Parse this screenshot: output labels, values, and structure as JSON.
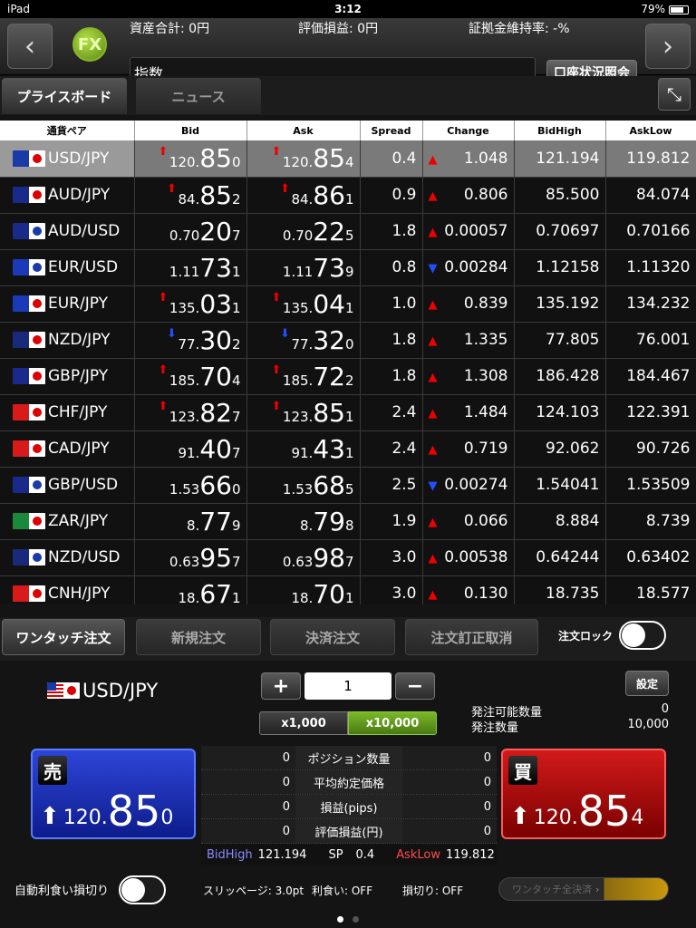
{
  "status": {
    "device": "iPad",
    "time": "3:12",
    "battery": "79%"
  },
  "header": {
    "total_assets": "資産合計: 0円",
    "unrealized_pl": "評価損益: 0円",
    "margin_ratio": "証拠金維持率: -%",
    "search_value": "指数",
    "account_button": "口座状況照会",
    "logo": "FX"
  },
  "tabs": {
    "price_board": "プライスボード",
    "news": "ニュース"
  },
  "columns": [
    "通貨ペア",
    "Bid",
    "Ask",
    "Spread",
    "Change",
    "BidHigh",
    "AskLow"
  ],
  "rates": [
    {
      "pair": "USD/JPY",
      "flag1": "#1a3aa8",
      "flag2dot": "#d00",
      "bid_a": "120.",
      "bid_b": "85",
      "bid_c": "0",
      "bid_dir": "up",
      "ask_a": "120.",
      "ask_b": "85",
      "ask_c": "4",
      "ask_dir": "up",
      "spread": "0.4",
      "change": "1.048",
      "change_dir": "up",
      "high": "121.194",
      "low": "119.812"
    },
    {
      "pair": "AUD/JPY",
      "flag1": "#1a2a8a",
      "flag2dot": "#d00",
      "bid_a": "84.",
      "bid_b": "85",
      "bid_c": "2",
      "bid_dir": "up",
      "ask_a": "84.",
      "ask_b": "86",
      "ask_c": "1",
      "ask_dir": "up",
      "spread": "0.9",
      "change": "0.806",
      "change_dir": "up",
      "high": "85.500",
      "low": "84.074"
    },
    {
      "pair": "AUD/USD",
      "flag1": "#1a2a8a",
      "flag2dot": "#1a3aa8",
      "bid_a": "0.70",
      "bid_b": "20",
      "bid_c": "7",
      "bid_dir": "",
      "ask_a": "0.70",
      "ask_b": "22",
      "ask_c": "5",
      "ask_dir": "",
      "spread": "1.8",
      "change": "0.00057",
      "change_dir": "up",
      "high": "0.70697",
      "low": "0.70166"
    },
    {
      "pair": "EUR/USD",
      "flag1": "#1a3ab8",
      "flag2dot": "#1a3aa8",
      "bid_a": "1.11",
      "bid_b": "73",
      "bid_c": "1",
      "bid_dir": "",
      "ask_a": "1.11",
      "ask_b": "73",
      "ask_c": "9",
      "ask_dir": "",
      "spread": "0.8",
      "change": "0.00284",
      "change_dir": "dn",
      "high": "1.12158",
      "low": "1.11320"
    },
    {
      "pair": "EUR/JPY",
      "flag1": "#1a3ab8",
      "flag2dot": "#d00",
      "bid_a": "135.",
      "bid_b": "03",
      "bid_c": "1",
      "bid_dir": "up",
      "ask_a": "135.",
      "ask_b": "04",
      "ask_c": "1",
      "ask_dir": "up",
      "spread": "1.0",
      "change": "0.839",
      "change_dir": "up",
      "high": "135.192",
      "low": "134.232"
    },
    {
      "pair": "NZD/JPY",
      "flag1": "#1a2a7a",
      "flag2dot": "#d00",
      "bid_a": "77.",
      "bid_b": "30",
      "bid_c": "2",
      "bid_dir": "dn",
      "ask_a": "77.",
      "ask_b": "32",
      "ask_c": "0",
      "ask_dir": "dn",
      "spread": "1.8",
      "change": "1.335",
      "change_dir": "up",
      "high": "77.805",
      "low": "76.001"
    },
    {
      "pair": "GBP/JPY",
      "flag1": "#1a2a8a",
      "flag2dot": "#d00",
      "bid_a": "185.",
      "bid_b": "70",
      "bid_c": "4",
      "bid_dir": "up",
      "ask_a": "185.",
      "ask_b": "72",
      "ask_c": "2",
      "ask_dir": "up",
      "spread": "1.8",
      "change": "1.308",
      "change_dir": "up",
      "high": "186.428",
      "low": "184.467"
    },
    {
      "pair": "CHF/JPY",
      "flag1": "#d81a1a",
      "flag2dot": "#d00",
      "bid_a": "123.",
      "bid_b": "82",
      "bid_c": "7",
      "bid_dir": "up",
      "ask_a": "123.",
      "ask_b": "85",
      "ask_c": "1",
      "ask_dir": "up",
      "spread": "2.4",
      "change": "1.484",
      "change_dir": "up",
      "high": "124.103",
      "low": "122.391"
    },
    {
      "pair": "CAD/JPY",
      "flag1": "#d81a1a",
      "flag2dot": "#d00",
      "bid_a": "91.",
      "bid_b": "40",
      "bid_c": "7",
      "bid_dir": "",
      "ask_a": "91.",
      "ask_b": "43",
      "ask_c": "1",
      "ask_dir": "",
      "spread": "2.4",
      "change": "0.719",
      "change_dir": "up",
      "high": "92.062",
      "low": "90.726"
    },
    {
      "pair": "GBP/USD",
      "flag1": "#1a2a8a",
      "flag2dot": "#1a3aa8",
      "bid_a": "1.53",
      "bid_b": "66",
      "bid_c": "0",
      "bid_dir": "",
      "ask_a": "1.53",
      "ask_b": "68",
      "ask_c": "5",
      "ask_dir": "",
      "spread": "2.5",
      "change": "0.00274",
      "change_dir": "dn",
      "high": "1.54041",
      "low": "1.53509"
    },
    {
      "pair": "ZAR/JPY",
      "flag1": "#1a8a3a",
      "flag2dot": "#d00",
      "bid_a": "8.",
      "bid_b": "77",
      "bid_c": "9",
      "bid_dir": "",
      "ask_a": "8.",
      "ask_b": "79",
      "ask_c": "8",
      "ask_dir": "",
      "spread": "1.9",
      "change": "0.066",
      "change_dir": "up",
      "high": "8.884",
      "low": "8.739"
    },
    {
      "pair": "NZD/USD",
      "flag1": "#1a2a7a",
      "flag2dot": "#1a3aa8",
      "bid_a": "0.63",
      "bid_b": "95",
      "bid_c": "7",
      "bid_dir": "",
      "ask_a": "0.63",
      "ask_b": "98",
      "ask_c": "7",
      "ask_dir": "",
      "spread": "3.0",
      "change": "0.00538",
      "change_dir": "up",
      "high": "0.64244",
      "low": "0.63402"
    },
    {
      "pair": "CNH/JPY",
      "flag1": "#d81a1a",
      "flag2dot": "#d00",
      "bid_a": "18.",
      "bid_b": "67",
      "bid_c": "1",
      "bid_dir": "",
      "ask_a": "18.",
      "ask_b": "70",
      "ask_c": "1",
      "ask_dir": "",
      "spread": "3.0",
      "change": "0.130",
      "change_dir": "up",
      "high": "18.735",
      "low": "18.577"
    }
  ],
  "order_tabs": {
    "one_touch": "ワンタッチ注文",
    "new": "新規注文",
    "settle": "決済注文",
    "modify": "注文訂正取消",
    "lock": "注文ロック"
  },
  "order": {
    "pair": "USD/JPY",
    "plus": "+",
    "minus": "−",
    "qty": "1",
    "mult1": "x1,000",
    "mult2": "x10,000",
    "settings": "設定",
    "available_label": "発注可能数量",
    "available_value": "0",
    "order_qty_label": "発注数量",
    "order_qty_value": "10,000",
    "sell_label": "売",
    "sell_a": "120.",
    "sell_b": "85",
    "sell_c": "0",
    "buy_label": "買",
    "buy_a": "120.",
    "buy_b": "85",
    "buy_c": "4",
    "stats": [
      {
        "left": "0",
        "label": "ポジション数量",
        "right": "0"
      },
      {
        "left": "0",
        "label": "平均約定価格",
        "right": "0"
      },
      {
        "left": "0",
        "label": "損益(pips)",
        "right": "0"
      },
      {
        "left": "0",
        "label": "評価損益(円)",
        "right": "0"
      }
    ],
    "bidhigh_label": "BidHigh",
    "bidhigh_value": "121.194",
    "sp_label": "SP",
    "sp_value": "0.4",
    "asklow_label": "AskLow",
    "asklow_value": "119.812",
    "auto_label": "自動利食い損切り",
    "slippage": "スリッページ: 3.0pt",
    "take_profit": "利食い: OFF",
    "stop_loss": "損切り: OFF",
    "settle_all": "ワンタッチ全決済"
  },
  "colors": {
    "up": "#e00000",
    "down": "#2050ff",
    "sell": "#1a30c0",
    "buy": "#c00000",
    "accent_green": "#6a9a1a"
  }
}
